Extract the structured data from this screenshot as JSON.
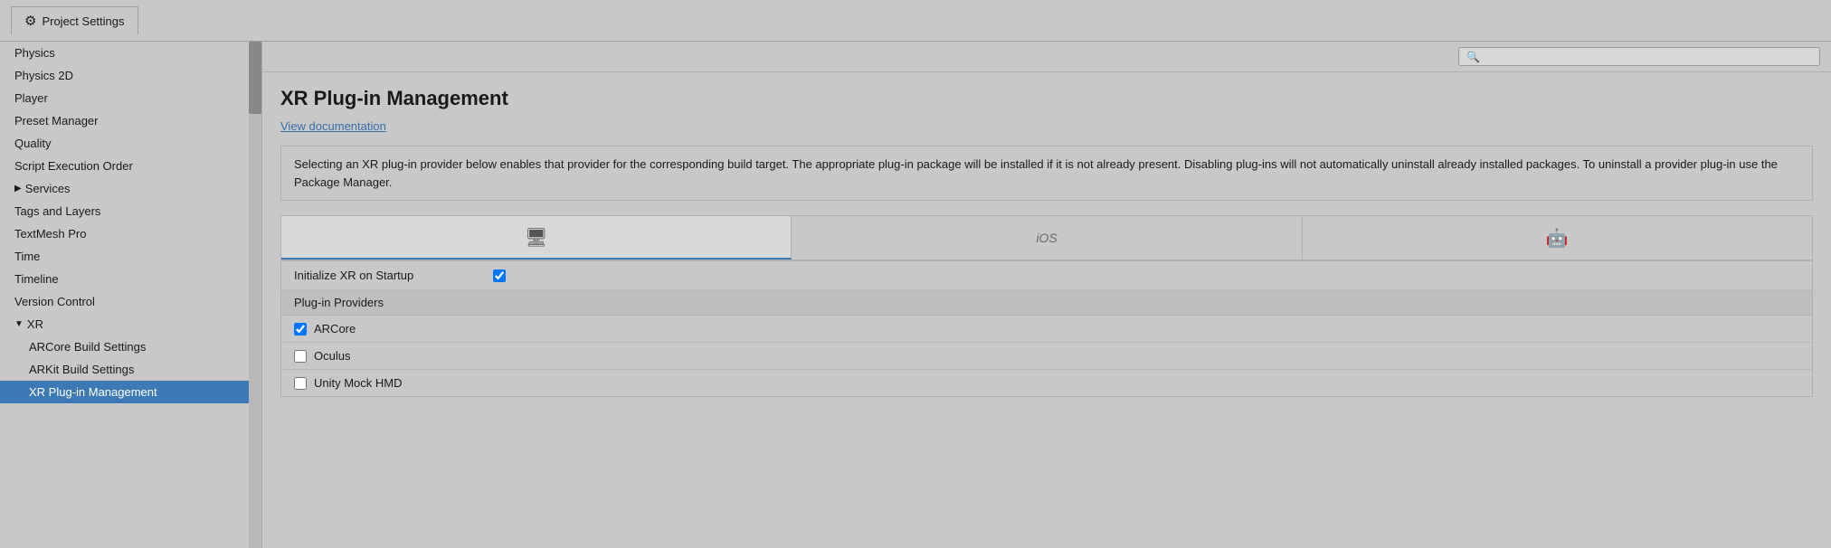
{
  "titleBar": {
    "title": "Project Settings",
    "icon": "⚙"
  },
  "search": {
    "placeholder": ""
  },
  "sidebar": {
    "items": [
      {
        "id": "physics",
        "label": "Physics",
        "indent": false,
        "active": false
      },
      {
        "id": "physics2d",
        "label": "Physics 2D",
        "indent": false,
        "active": false
      },
      {
        "id": "player",
        "label": "Player",
        "indent": false,
        "active": false
      },
      {
        "id": "presetmanager",
        "label": "Preset Manager",
        "indent": false,
        "active": false
      },
      {
        "id": "quality",
        "label": "Quality",
        "indent": false,
        "active": false
      },
      {
        "id": "scriptexecution",
        "label": "Script Execution Order",
        "indent": false,
        "active": false
      },
      {
        "id": "services",
        "label": "Services",
        "indent": false,
        "active": false,
        "isGroup": true,
        "expanded": false
      },
      {
        "id": "tagsandlayers",
        "label": "Tags and Layers",
        "indent": false,
        "active": false
      },
      {
        "id": "textmeshpro",
        "label": "TextMesh Pro",
        "indent": false,
        "active": false
      },
      {
        "id": "time",
        "label": "Time",
        "indent": false,
        "active": false
      },
      {
        "id": "timeline",
        "label": "Timeline",
        "indent": false,
        "active": false
      },
      {
        "id": "versioncontrol",
        "label": "Version Control",
        "indent": false,
        "active": false
      },
      {
        "id": "xr",
        "label": "XR",
        "indent": false,
        "active": false,
        "isGroup": true,
        "expanded": true
      },
      {
        "id": "arcore",
        "label": "ARCore Build Settings",
        "indent": true,
        "active": false
      },
      {
        "id": "arkit",
        "label": "ARKit Build Settings",
        "indent": true,
        "active": false
      },
      {
        "id": "xrplugin",
        "label": "XR Plug-in Management",
        "indent": true,
        "active": true
      }
    ]
  },
  "content": {
    "pageTitle": "XR Plug-in Management",
    "docLink": "View documentation",
    "infoText": "Selecting an XR plug-in provider below enables that provider for the corresponding build target. The appropriate plug-in package will be installed if it is not already present. Disabling plug-ins will not automatically uninstall already installed packages. To uninstall a provider plug-in use the Package Manager.",
    "platformTabs": [
      {
        "id": "desktop",
        "icon": "🖥",
        "label": "Desktop",
        "active": true
      },
      {
        "id": "ios",
        "icon": "iOS",
        "label": "iOS",
        "active": false
      },
      {
        "id": "android",
        "icon": "🤖",
        "label": "Android",
        "active": false
      }
    ],
    "initXR": {
      "label": "Initialize XR on Startup",
      "checked": true
    },
    "pluginProviders": {
      "header": "Plug-in Providers",
      "plugins": [
        {
          "id": "arcore",
          "name": "ARCore",
          "checked": true
        },
        {
          "id": "oculus",
          "name": "Oculus",
          "checked": false
        },
        {
          "id": "unitymockhmd",
          "name": "Unity Mock HMD",
          "checked": false
        }
      ]
    }
  }
}
